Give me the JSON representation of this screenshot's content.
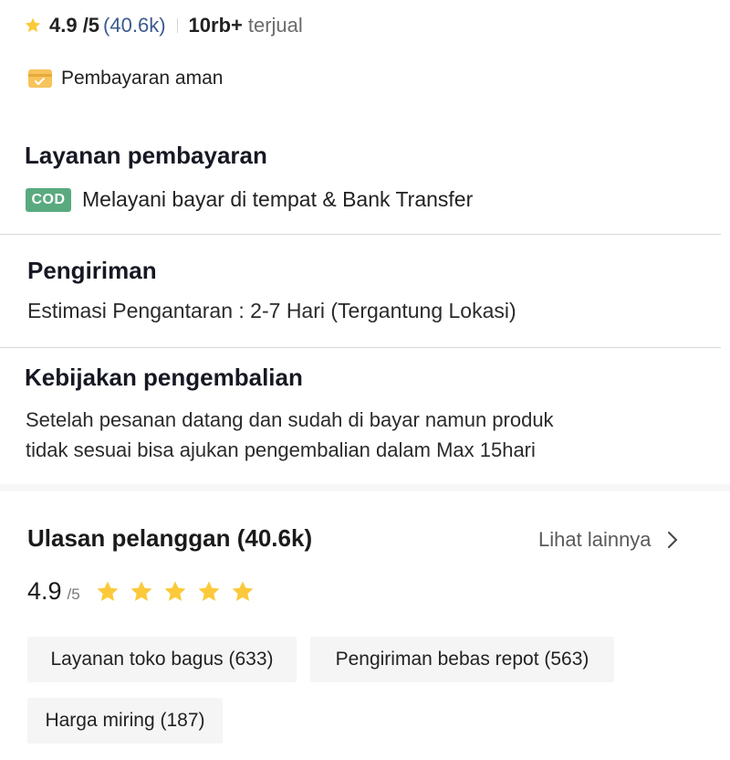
{
  "rating": {
    "score": "4.9 /5",
    "count": "(40.6k)",
    "sold_number": "10rb+",
    "sold_label": "terjual"
  },
  "secure_payment": {
    "label": "Pembayaran aman"
  },
  "payment": {
    "title": "Layanan pembayaran",
    "badge": "COD",
    "description": "Melayani bayar di tempat & Bank Transfer",
    "badge_color": "#5aaa7f"
  },
  "shipping": {
    "title": "Pengiriman",
    "estimate": "Estimasi Pengantaran : 2-7 Hari (Tergantung Lokasi)"
  },
  "returns": {
    "title": "Kebijakan pengembalian",
    "line1": "Setelah pesanan datang dan sudah di bayar namun produk",
    "line2": "tidak sesuai bisa ajukan pengembalian dalam Max 15hari"
  },
  "reviews": {
    "title": "Ulasan pelanggan (40.6k)",
    "see_more": "Lihat lainnya",
    "score": "4.9",
    "out_of": "/5",
    "stars": 5,
    "star_color": "#fbc93a",
    "tags": [
      {
        "label": "Layanan toko bagus (633)"
      },
      {
        "label": "Pengiriman bebas repot (563)"
      },
      {
        "label": "Harga miring (187)"
      }
    ]
  }
}
